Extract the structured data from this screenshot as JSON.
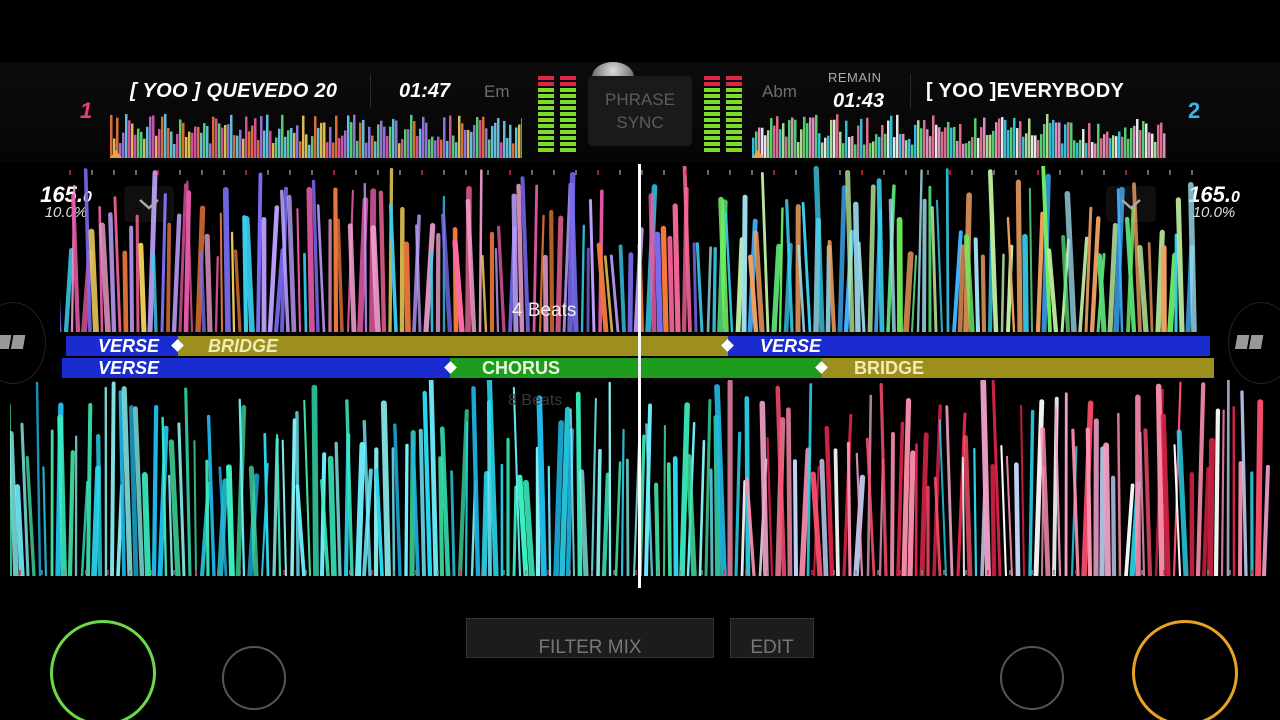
{
  "deck1": {
    "number": "1",
    "number_color": "#e8416f",
    "title": "[ YOO ] QUEVEDO 20",
    "time": "01:47",
    "key": "Em",
    "bpm": "165.0",
    "bpm_int": "165.",
    "bpm_dec": "0",
    "pitch": "10.0%"
  },
  "deck2": {
    "number": "2",
    "number_color": "#3ab6e8",
    "title": "[ YOO ]EVERYBODY",
    "remain_label": "REMAIN",
    "time": "01:43",
    "key": "Abm",
    "bpm": "165.0",
    "bpm_int": "165.",
    "bpm_dec": "0",
    "pitch": "10.0%"
  },
  "phrase_sync": {
    "line1": "PHRASE",
    "line2": "SYNC"
  },
  "beat_jump": {
    "upper": "4 Beats",
    "lower": "8 Beats"
  },
  "phrases_upper": [
    {
      "label": "VERSE",
      "color": "#1a2bd0"
    },
    {
      "label": "BRIDGE",
      "color": "#9c8f1e"
    },
    {
      "label": "VERSE",
      "color": "#1a2bd0"
    }
  ],
  "phrases_lower": [
    {
      "label": "VERSE",
      "color": "#1a2bd0"
    },
    {
      "label": "CHORUS",
      "color": "#1e9c1e"
    },
    {
      "label": "BRIDGE",
      "color": "#9c8f1e"
    }
  ],
  "bottom": {
    "filter_mix": "FILTER MIX",
    "edit": "EDIT"
  },
  "colors": {
    "jog_left": "#6bd94a",
    "jog_right": "#e8a322",
    "meter_green": "#7bdc2a",
    "meter_red": "#e0254a"
  }
}
